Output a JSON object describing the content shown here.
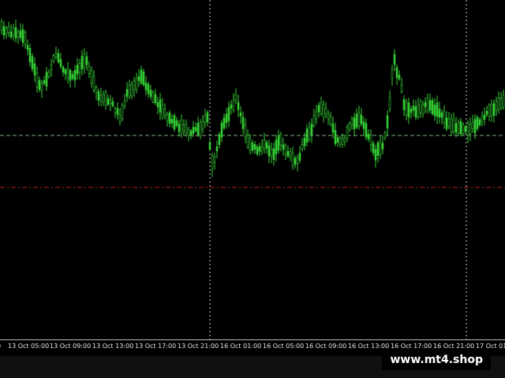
{
  "chart": {
    "background_color": "#000000",
    "candle_color": "#33cc33",
    "grid_color": "#d0d0d0",
    "bid_line_color": "#7aa87a",
    "level_line_color": "#b02020",
    "line_chart_label": "price candles (green bars)",
    "price_min": 0.0,
    "price_max": 1.0,
    "bid_level": 0.7,
    "marker_level": 0.55
  },
  "time_axis": {
    "labels": [
      "13 Oct 05:00",
      "13 Oct 09:00",
      "13 Oct 13:00",
      "13 Oct 17:00",
      "13 Oct 21:00",
      "16 Oct 01:00",
      "16 Oct 05:00",
      "16 Oct 09:00",
      "16 Oct 13:00",
      "16 Oct 17:00",
      "16 Oct 21:00",
      "17 Oct 01:00"
    ],
    "left_cut_label": "0"
  },
  "watermark": {
    "text": "www.mt4.shop"
  }
}
